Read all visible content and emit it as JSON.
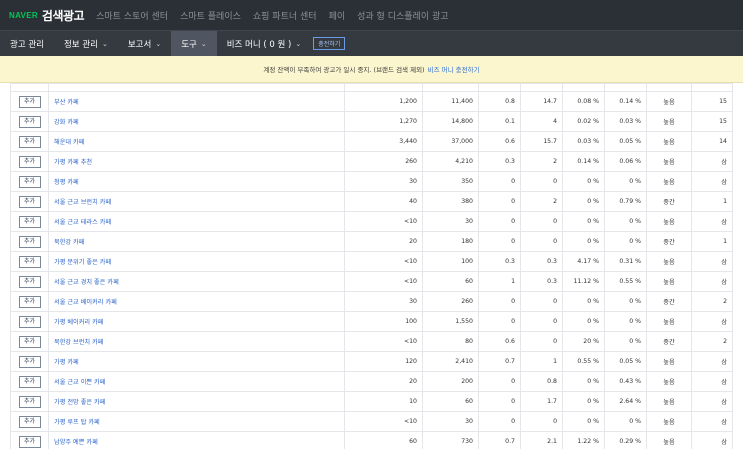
{
  "topbar": {
    "logo": "NAVER",
    "title": "검색광고",
    "links": [
      "스마트 스토어 센터",
      "스마트 플레이스",
      "쇼핑 파트너 센터",
      "페이",
      "성과 형 디스플레이 광고"
    ]
  },
  "navbar": {
    "items": [
      {
        "label": "광고 관리",
        "chevron": ""
      },
      {
        "label": "정보 관리",
        "chevron": "⌄"
      },
      {
        "label": "보고서",
        "chevron": "⌄"
      },
      {
        "label": "도구",
        "chevron": "⌄"
      },
      {
        "label": "비즈 머니 ( 0 원 )",
        "chevron": "⌄"
      }
    ],
    "charge_button": "충전하기"
  },
  "notice": {
    "text": "계정 잔액이 부족하여 광고가 일시 중지. (브랜드 검색 제외)",
    "link": "비즈 머니 충전하기"
  },
  "table": {
    "add_label": "추가",
    "rows": [
      [
        "부산 카페",
        "1,200",
        "11,400",
        "0.8",
        "14.7",
        "0.08 %",
        "0.14 %",
        "높음",
        "15"
      ],
      [
        "강화 카페",
        "1,270",
        "14,800",
        "0.1",
        "4",
        "0.02 %",
        "0.03 %",
        "높음",
        "15"
      ],
      [
        "해운대 카페",
        "3,440",
        "37,000",
        "0.6",
        "15.7",
        "0.03 %",
        "0.05 %",
        "높음",
        "14"
      ],
      [
        "가평 카페 추천",
        "260",
        "4,210",
        "0.3",
        "2",
        "0.14 %",
        "0.06 %",
        "높음",
        "삼"
      ],
      [
        "청평 카페",
        "30",
        "350",
        "0",
        "0",
        "0 %",
        "0 %",
        "높음",
        "삼"
      ],
      [
        "서울 근교 브런치 카페",
        "40",
        "380",
        "0",
        "2",
        "0 %",
        "0.79 %",
        "중간",
        "1"
      ],
      [
        "서울 근교 테라스 카페",
        "<10",
        "30",
        "0",
        "0",
        "0 %",
        "0 %",
        "높음",
        "삼"
      ],
      [
        "북한강 카페",
        "20",
        "180",
        "0",
        "0",
        "0 %",
        "0 %",
        "중간",
        "1"
      ],
      [
        "가평 분위기 좋은 카페",
        "<10",
        "100",
        "0.3",
        "0.3",
        "4.17 %",
        "0.31 %",
        "높음",
        "삼"
      ],
      [
        "서울 근교 경치 좋은 카페",
        "<10",
        "60",
        "1",
        "0.3",
        "11.12 %",
        "0.55 %",
        "높음",
        "삼"
      ],
      [
        "서울 근교 베이커리 카페",
        "30",
        "260",
        "0",
        "0",
        "0 %",
        "0 %",
        "중간",
        "2"
      ],
      [
        "가평 베이커리 카페",
        "100",
        "1,550",
        "0",
        "0",
        "0 %",
        "0 %",
        "높음",
        "삼"
      ],
      [
        "북한강 브런치 카페",
        "<10",
        "80",
        "0.6",
        "0",
        "20 %",
        "0 %",
        "중간",
        "2"
      ],
      [
        "가평 카페",
        "120",
        "2,410",
        "0.7",
        "1",
        "0.55 %",
        "0.05 %",
        "높음",
        "삼"
      ],
      [
        "서울 근교 이쁜 카페",
        "20",
        "200",
        "0",
        "0.8",
        "0 %",
        "0.43 %",
        "높음",
        "삼"
      ],
      [
        "가평 전망 좋은 카페",
        "10",
        "60",
        "0",
        "1.7",
        "0 %",
        "2.64 %",
        "높음",
        "삼"
      ],
      [
        "가평 루프 탑 카페",
        "<10",
        "30",
        "0",
        "0",
        "0 %",
        "0 %",
        "높음",
        "삼"
      ],
      [
        "남양주 예쁜 카페",
        "60",
        "730",
        "0.7",
        "2.1",
        "1.22 %",
        "0.29 %",
        "높음",
        "삼"
      ]
    ]
  },
  "colors": {
    "topbar": "#2b2f36",
    "navbar": "#353a41",
    "brand_green": "#03c75a",
    "notice_bg": "#fcf6cf",
    "link_blue": "#2b63c9"
  }
}
